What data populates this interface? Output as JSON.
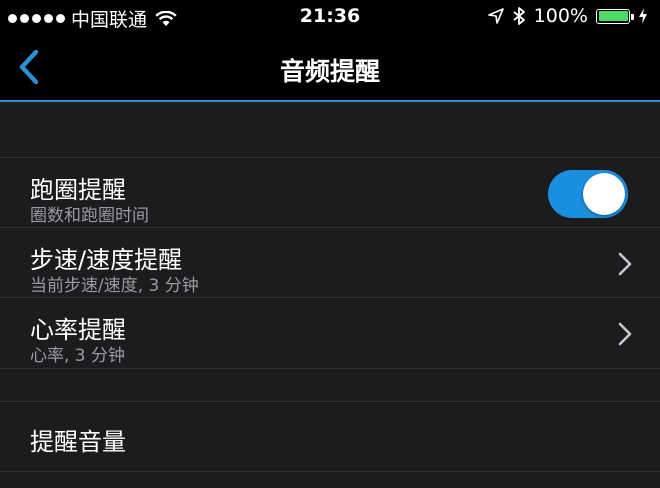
{
  "status_bar": {
    "carrier": "中国联通",
    "time": "21:36",
    "battery": "100%",
    "battery_color": "#4cd964"
  },
  "nav": {
    "title": "音频提醒",
    "accent_color": "#2a8fd4"
  },
  "settings": {
    "lap_alert": {
      "title": "跑圈提醒",
      "subtitle": "圈数和跑圈时间",
      "enabled": true
    },
    "pace_alert": {
      "title": "步速/速度提醒",
      "subtitle": "当前步速/速度, 3 分钟"
    },
    "hr_alert": {
      "title": "心率提醒",
      "subtitle": "心率, 3 分钟"
    },
    "volume": {
      "title": "提醒音量"
    }
  },
  "icons": [
    "wifi-icon",
    "location-icon",
    "bluetooth-icon",
    "battery-icon",
    "charging-icon",
    "back-chevron-icon",
    "chevron-right-icon"
  ]
}
